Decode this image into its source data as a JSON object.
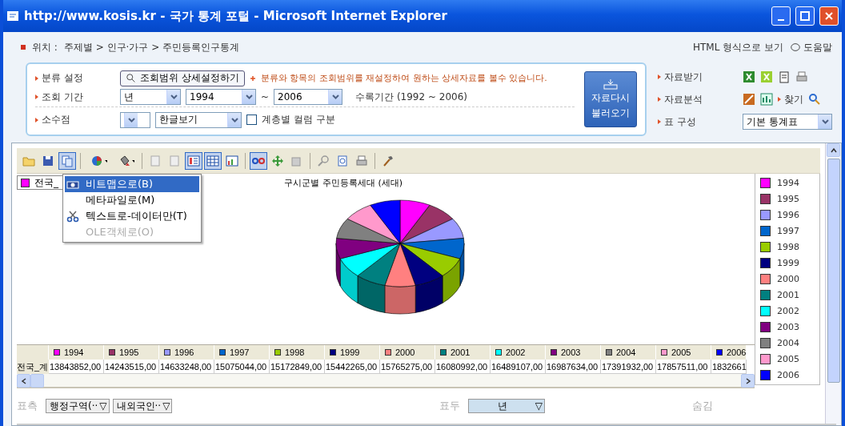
{
  "window": {
    "title": "http://www.kosis.kr - 국가 통계 포털 - Microsoft Internet Explorer"
  },
  "location": {
    "label": "위치 :",
    "path": "주제별 > 인구·가구 > 주민등록인구통계"
  },
  "header_links": [
    "HTML 형식으로 보기",
    "도움말"
  ],
  "filters": {
    "category": {
      "label": "분류 설정",
      "button": "조회범위 상세설정하기",
      "note": "분류와 항목의 조회범위를 재설정하여 원하는 상세자료를 볼수 있습니다."
    },
    "period": {
      "label": "조회 기간",
      "unit": "년",
      "from": "1994",
      "separator": "~",
      "to": "2006",
      "note": "수록기간 (1992 ~ 2006)"
    },
    "decimal": {
      "label": "소수점",
      "display": "한글보기",
      "checkbox": {
        "label": "계층별 컬럼 구분",
        "checked": false
      }
    }
  },
  "reload_button": [
    "자료다시",
    "불러오기"
  ],
  "side_tools": {
    "download": "자료받기",
    "analysis": "자료분석",
    "find": "찾기",
    "layout_label": "표 구성",
    "layout_value": "기본 통계표"
  },
  "toolbar": [
    {
      "kind": "open",
      "pressed": false
    },
    {
      "kind": "save",
      "pressed": false
    },
    {
      "kind": "copy",
      "pressed": true
    },
    {
      "kind": "sep"
    },
    {
      "kind": "pie",
      "pressed": false
    },
    {
      "kind": "paint",
      "pressed": false
    },
    {
      "kind": "sep"
    },
    {
      "kind": "doc",
      "pressed": false
    },
    {
      "kind": "doc",
      "pressed": false
    },
    {
      "kind": "split",
      "pressed": true
    },
    {
      "kind": "grid",
      "pressed": true
    },
    {
      "kind": "chart",
      "pressed": false
    },
    {
      "kind": "sep"
    },
    {
      "kind": "glasses",
      "pressed": true
    },
    {
      "kind": "move",
      "pressed": false
    },
    {
      "kind": "export",
      "pressed": false
    },
    {
      "kind": "sep"
    },
    {
      "kind": "zoom",
      "pressed": false
    },
    {
      "kind": "preview",
      "pressed": false
    },
    {
      "kind": "print",
      "pressed": false
    },
    {
      "kind": "sep"
    },
    {
      "kind": "hammer",
      "pressed": false
    }
  ],
  "copy_menu": [
    {
      "label": "비트맵으로(B)",
      "kind": "camera",
      "selected": true,
      "disabled": false
    },
    {
      "label": "메타파일로(M)",
      "kind": "plain",
      "selected": false,
      "disabled": false
    },
    {
      "label": "텍스트로-데이터만(T)",
      "kind": "scissors",
      "selected": false,
      "disabled": false
    },
    {
      "label": "OLE객체로(O)",
      "kind": "plain",
      "selected": false,
      "disabled": true
    }
  ],
  "series_chip": {
    "label": "전국_",
    "color": "#ff00ff"
  },
  "chart": {
    "title": "구시군별 주민등록세대 (세대)"
  },
  "legend": [
    {
      "year": "1994",
      "color": "#ff00ff"
    },
    {
      "year": "1995",
      "color": "#993366"
    },
    {
      "year": "1996",
      "color": "#9999ff"
    },
    {
      "year": "1997",
      "color": "#0066cc"
    },
    {
      "year": "1998",
      "color": "#99cc00"
    },
    {
      "year": "1999",
      "color": "#000080"
    },
    {
      "year": "2000",
      "color": "#ff8080"
    },
    {
      "year": "2001",
      "color": "#008080"
    },
    {
      "year": "2002",
      "color": "#00ffff"
    },
    {
      "year": "2003",
      "color": "#800080"
    },
    {
      "year": "2004",
      "color": "#808080"
    },
    {
      "year": "2005",
      "color": "#ff99cc"
    },
    {
      "year": "2006",
      "color": "#0000ff"
    }
  ],
  "table": {
    "row_header": "전국_계",
    "columns": [
      {
        "year": "1994",
        "color": "#ff00ff",
        "value": "13843852,00"
      },
      {
        "year": "1995",
        "color": "#993366",
        "value": "14243515,00"
      },
      {
        "year": "1996",
        "color": "#9999ff",
        "value": "14633248,00"
      },
      {
        "year": "1997",
        "color": "#0066cc",
        "value": "15075044,00"
      },
      {
        "year": "1998",
        "color": "#99cc00",
        "value": "15172849,00"
      },
      {
        "year": "1999",
        "color": "#000080",
        "value": "15442265,00"
      },
      {
        "year": "2000",
        "color": "#ff8080",
        "value": "15765275,00"
      },
      {
        "year": "2001",
        "color": "#008080",
        "value": "16080992,00"
      },
      {
        "year": "2002",
        "color": "#00ffff",
        "value": "16489107,00"
      },
      {
        "year": "2003",
        "color": "#800080",
        "value": "16987634,00"
      },
      {
        "year": "2004",
        "color": "#808080",
        "value": "17391932,00"
      },
      {
        "year": "2005",
        "color": "#ff99cc",
        "value": "17857511,00"
      },
      {
        "year": "2006",
        "color": "#0000ff",
        "value": "1832661"
      }
    ]
  },
  "pivot": {
    "rows_label": "표측",
    "rows": [
      {
        "label": "행정구역(··",
        "arrow": "▽"
      },
      {
        "label": "내외국인··",
        "arrow": "▽"
      }
    ],
    "columns_label": "표두",
    "columns": [
      {
        "label": "년",
        "arrow": "▽"
      }
    ],
    "hidden_label": "숨김"
  }
}
